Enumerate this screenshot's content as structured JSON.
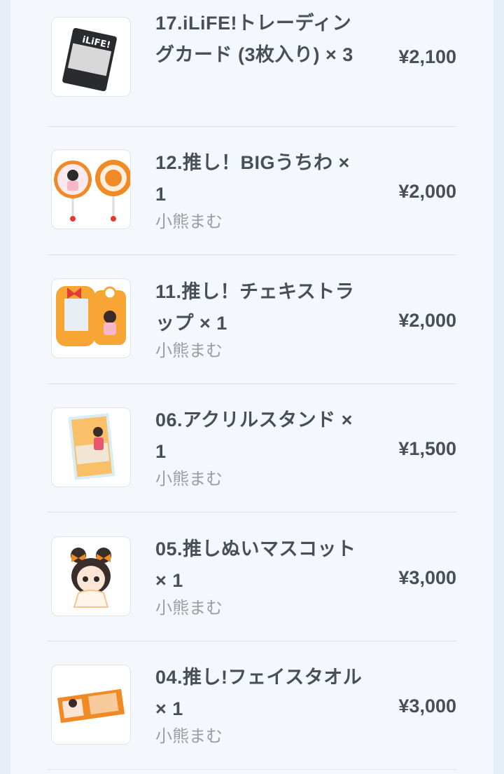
{
  "items": [
    {
      "name": "17.iLiFE!トレーディングカード (3枚入り) × 3",
      "artist": "",
      "price": "¥2,100",
      "thumb_text": "iLiFE!"
    },
    {
      "name": "12.推し！BIGうちわ × 1",
      "artist": "小熊まむ",
      "price": "¥2,000"
    },
    {
      "name": "11.推し！チェキストラップ × 1",
      "artist": "小熊まむ",
      "price": "¥2,000"
    },
    {
      "name": "06.アクリルスタンド × 1",
      "artist": "小熊まむ",
      "price": "¥1,500"
    },
    {
      "name": "05.推しぬいマスコット × 1",
      "artist": "小熊まむ",
      "price": "¥3,000"
    },
    {
      "name": "04.推し!フェイスタオル × 1",
      "artist": "小熊まむ",
      "price": "¥3,000"
    }
  ],
  "colors": {
    "accent_orange": "#f08a24",
    "text_main": "#4a4f55",
    "text_sub": "#9a9ea3"
  }
}
